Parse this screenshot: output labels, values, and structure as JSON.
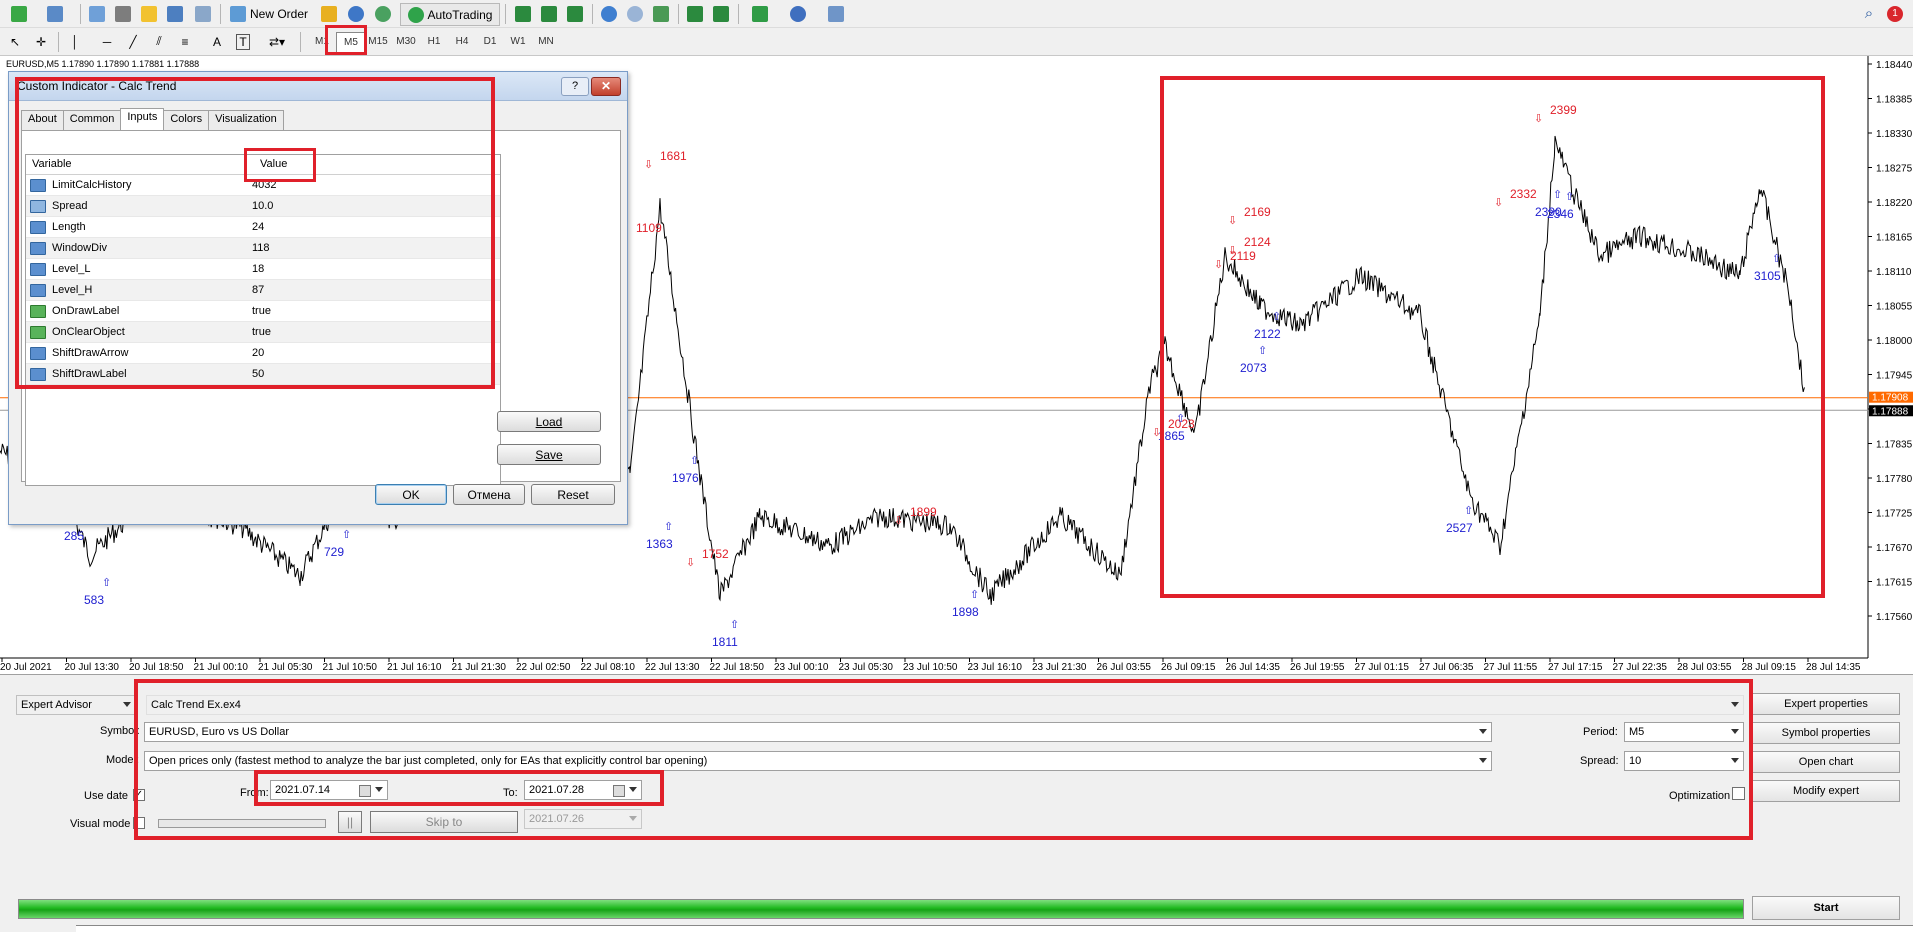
{
  "toolbar": {
    "new_order": "New Order",
    "autotrading": "AutoTrading",
    "timeframes": [
      "M1",
      "M5",
      "M15",
      "M30",
      "H1",
      "H4",
      "D1",
      "W1",
      "MN"
    ],
    "active_timeframe": "M5",
    "notification_count": "1"
  },
  "chart": {
    "header": "EURUSD,M5  1.17890 1.17890 1.17881 1.17888",
    "price_ticks": [
      "1.18440",
      "1.18385",
      "1.18330",
      "1.18275",
      "1.18220",
      "1.18165",
      "1.18110",
      "1.18055",
      "1.18000",
      "1.17945",
      "1.17890",
      "1.17835",
      "1.17780",
      "1.17725",
      "1.17670",
      "1.17615",
      "1.17560"
    ],
    "bid_price": "1.17888",
    "ask_price": "1.17908",
    "time_ticks": [
      "20 Jul 2021",
      "20 Jul 13:30",
      "20 Jul 18:50",
      "21 Jul 00:10",
      "21 Jul 05:30",
      "21 Jul 10:50",
      "21 Jul 16:10",
      "21 Jul 21:30",
      "22 Jul 02:50",
      "22 Jul 08:10",
      "22 Jul 13:30",
      "22 Jul 18:50",
      "23 Jul 00:10",
      "23 Jul 05:30",
      "23 Jul 10:50",
      "23 Jul 16:10",
      "23 Jul 21:30",
      "26 Jul 03:55",
      "26 Jul 09:15",
      "26 Jul 14:35",
      "26 Jul 19:55",
      "27 Jul 01:15",
      "27 Jul 06:35",
      "27 Jul 11:55",
      "27 Jul 17:15",
      "27 Jul 22:35",
      "28 Jul 03:55",
      "28 Jul 09:15",
      "28 Jul 14:35"
    ],
    "red_labels": [
      "1681",
      "1109",
      "1752",
      "1899",
      "2023",
      "2169",
      "2124",
      "2119",
      "2332",
      "2399"
    ],
    "blue_labels": [
      "285",
      "583",
      "729",
      "1363",
      "1976",
      "1811",
      "1898",
      "1865",
      "2073",
      "2122",
      "2527",
      "2390",
      "2346",
      "3105"
    ],
    "colors": {
      "price_line": "#000000",
      "sell_label": "#e0202a",
      "buy_label": "#2020d0",
      "ask_line": "#ff6a00",
      "bid_line": "#9a9a9a"
    }
  },
  "dialog": {
    "title": "Custom Indicator - Calc Trend",
    "tabs": [
      "About",
      "Common",
      "Inputs",
      "Colors",
      "Visualization"
    ],
    "active_tab": "Inputs",
    "columns": {
      "variable": "Variable",
      "value": "Value"
    },
    "inputs": [
      {
        "name": "LimitCalcHistory",
        "value": "4032",
        "type": "int"
      },
      {
        "name": "Spread",
        "value": "10.0",
        "type": "double"
      },
      {
        "name": "Length",
        "value": "24",
        "type": "int"
      },
      {
        "name": "WindowDiv",
        "value": "118",
        "type": "int"
      },
      {
        "name": "Level_L",
        "value": "18",
        "type": "int"
      },
      {
        "name": "Level_H",
        "value": "87",
        "type": "int"
      },
      {
        "name": "OnDrawLabel",
        "value": "true",
        "type": "bool"
      },
      {
        "name": "OnClearObject",
        "value": "true",
        "type": "bool"
      },
      {
        "name": "ShiftDrawArrow",
        "value": "20",
        "type": "int"
      },
      {
        "name": "ShiftDrawLabel",
        "value": "50",
        "type": "int"
      }
    ],
    "load": "Load",
    "save": "Save",
    "ok": "OK",
    "cancel": "Отмена",
    "reset": "Reset"
  },
  "tester": {
    "type": "Expert Advisor",
    "expert": "Calc Trend Ex.ex4",
    "symbol_label": "Symbol:",
    "symbol": "EURUSD, Euro vs US Dollar",
    "model_label": "Model:",
    "model": "Open prices only (fastest method to analyze the bar just completed, only for EAs that explicitly control bar opening)",
    "use_date_label": "Use date",
    "use_date_checked": true,
    "from_label": "From:",
    "from": "2021.07.14",
    "to_label": "To:",
    "to": "2021.07.28",
    "visual_mode_label": "Visual mode",
    "skip_to": "Skip to",
    "skip_date": "2021.07.26",
    "period_label": "Period:",
    "period": "M5",
    "spread_label": "Spread:",
    "spread": "10",
    "optimization_label": "Optimization",
    "progress": 1.0,
    "buttons": {
      "expert_properties": "Expert properties",
      "symbol_properties": "Symbol properties",
      "open_chart": "Open chart",
      "modify_expert": "Modify expert",
      "start": "Start"
    }
  }
}
